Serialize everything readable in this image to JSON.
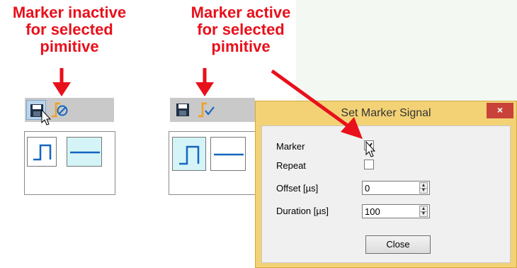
{
  "annotations": {
    "inactive": [
      "Marker inactive",
      "for selected",
      "pimitive"
    ],
    "active": [
      "Marker active",
      "for selected",
      "pimitive"
    ]
  },
  "dialog": {
    "title": "Set Marker Signal",
    "close_glyph": "×",
    "marker_label": "Marker",
    "marker_checked": true,
    "repeat_label": "Repeat",
    "repeat_checked": false,
    "offset_label": "Offset [µs]",
    "offset_value": "0",
    "duration_label": "Duration [µs]",
    "duration_value": "100",
    "close_button": "Close"
  },
  "colors": {
    "annotation_red": "#e8101b",
    "toolbar_gray": "#c9c9c9",
    "dialog_frame": "#f3d276",
    "close_red": "#c9423a",
    "selected_fill": "#d4f4f7",
    "icon_blue": "#1565c0",
    "marker_orange": "#f0a020"
  },
  "icons": [
    "save-icon",
    "marker-inactive-icon",
    "marker-active-icon",
    "step-pulse-icon",
    "flat-line-icon",
    "mouse-cursor-icon"
  ]
}
